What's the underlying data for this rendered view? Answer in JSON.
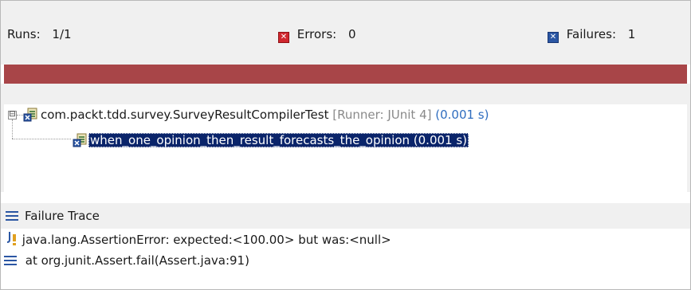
{
  "counters": {
    "runs_label": "Runs:",
    "runs_value": "1/1",
    "errors_label": "Errors:",
    "errors_value": "0",
    "failures_label": "Failures:",
    "failures_value": "1"
  },
  "progress": {
    "fraction": 1.0,
    "color": "#a84548"
  },
  "tree": {
    "root": {
      "name": "com.packt.tdd.survey.SurveyResultCompilerTest",
      "runner": "[Runner: JUnit 4]",
      "time": "(0.001 s)",
      "expander": "⊟"
    },
    "child": {
      "name": "when_one_opinion_then_result_forecasts_the_opinion (0.001 s)"
    }
  },
  "failure_trace": {
    "title": "Failure Trace",
    "lines": [
      {
        "text": "java.lang.AssertionError: expected:<100.00> but was:<null>",
        "icon": "junit-error-icon"
      },
      {
        "text": "at org.junit.Assert.fail(Assert.java:91)",
        "icon": "stack-frame-icon"
      }
    ]
  },
  "colors": {
    "failure_bar": "#a84548",
    "selection": "#0a246a",
    "time_text": "#2f6dbf",
    "error_icon": "#d0272e",
    "failure_icon": "#2b56a3"
  }
}
